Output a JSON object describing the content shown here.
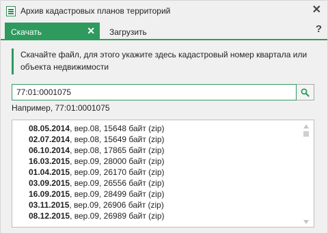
{
  "window": {
    "title": "Архив кадастровых планов территорий",
    "close_glyph": "✕",
    "icon": "document-list-icon"
  },
  "tabs": [
    {
      "label": "Скачать",
      "active": true,
      "close_glyph": "✕"
    },
    {
      "label": "Загрузить",
      "active": false
    }
  ],
  "help_glyph": "?",
  "notice": {
    "text": "Скачайте файл, для этого укажите здесь кадастровый номер квартала или объекта недвижимости"
  },
  "search": {
    "value": "77:01:0001075",
    "example": "Например, 77:01:0001075",
    "button_icon": "search-icon"
  },
  "files": [
    {
      "date": "08.05.2014",
      "info": ", вер.08, 15648 байт (zip)"
    },
    {
      "date": "02.07.2014",
      "info": ", вер.08, 15649 байт (zip)"
    },
    {
      "date": "06.10.2014",
      "info": ", вер.08, 17865 байт (zip)"
    },
    {
      "date": "16.03.2015",
      "info": ", вер.09, 28000 байт (zip)"
    },
    {
      "date": "01.04.2015",
      "info": ", вер.09, 26170 байт (zip)"
    },
    {
      "date": "03.09.2015",
      "info": ", вер.09, 26556 байт (zip)"
    },
    {
      "date": "16.09.2015",
      "info": ", вер.09, 28499 байт (zip)"
    },
    {
      "date": "03.11.2015",
      "info": ", вер.09, 26906 байт (zip)"
    },
    {
      "date": "08.12.2015",
      "info": ", вер.09, 26989 байт (zip)"
    }
  ],
  "colors": {
    "accent": "#2e9a5e"
  }
}
